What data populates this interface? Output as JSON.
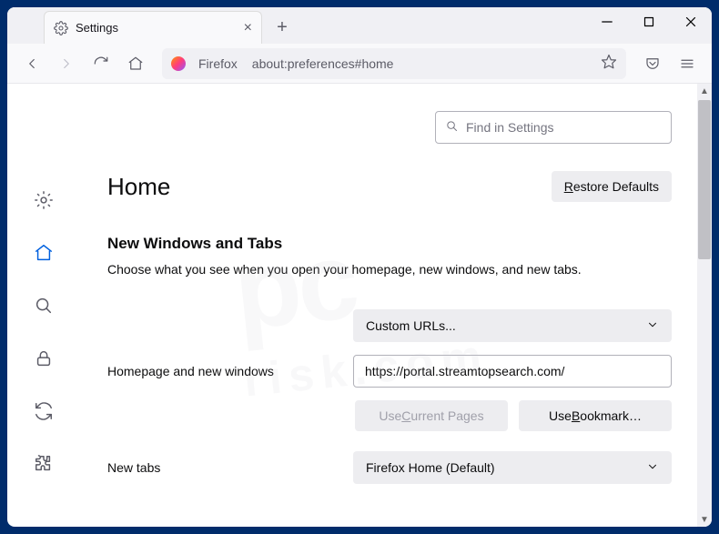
{
  "tab": {
    "title": "Settings"
  },
  "urlbar": {
    "identity": "Firefox",
    "address": "about:preferences#home"
  },
  "search": {
    "placeholder": "Find in Settings"
  },
  "page": {
    "heading": "Home",
    "restore_defaults": "Restore Defaults",
    "section_title": "New Windows and Tabs",
    "section_desc": "Choose what you see when you open your homepage, new windows, and new tabs."
  },
  "rows": {
    "homepage_label": "Homepage and new windows",
    "homepage_mode": "Custom URLs...",
    "homepage_url": "https://portal.streamtopsearch.com/",
    "use_current": "Use Current Pages",
    "use_bookmark": "Use Bookmark…",
    "newtabs_label": "New tabs",
    "newtabs_mode": "Firefox Home (Default)"
  },
  "watermark": {
    "main": "pc",
    "sub": "risk.com"
  }
}
